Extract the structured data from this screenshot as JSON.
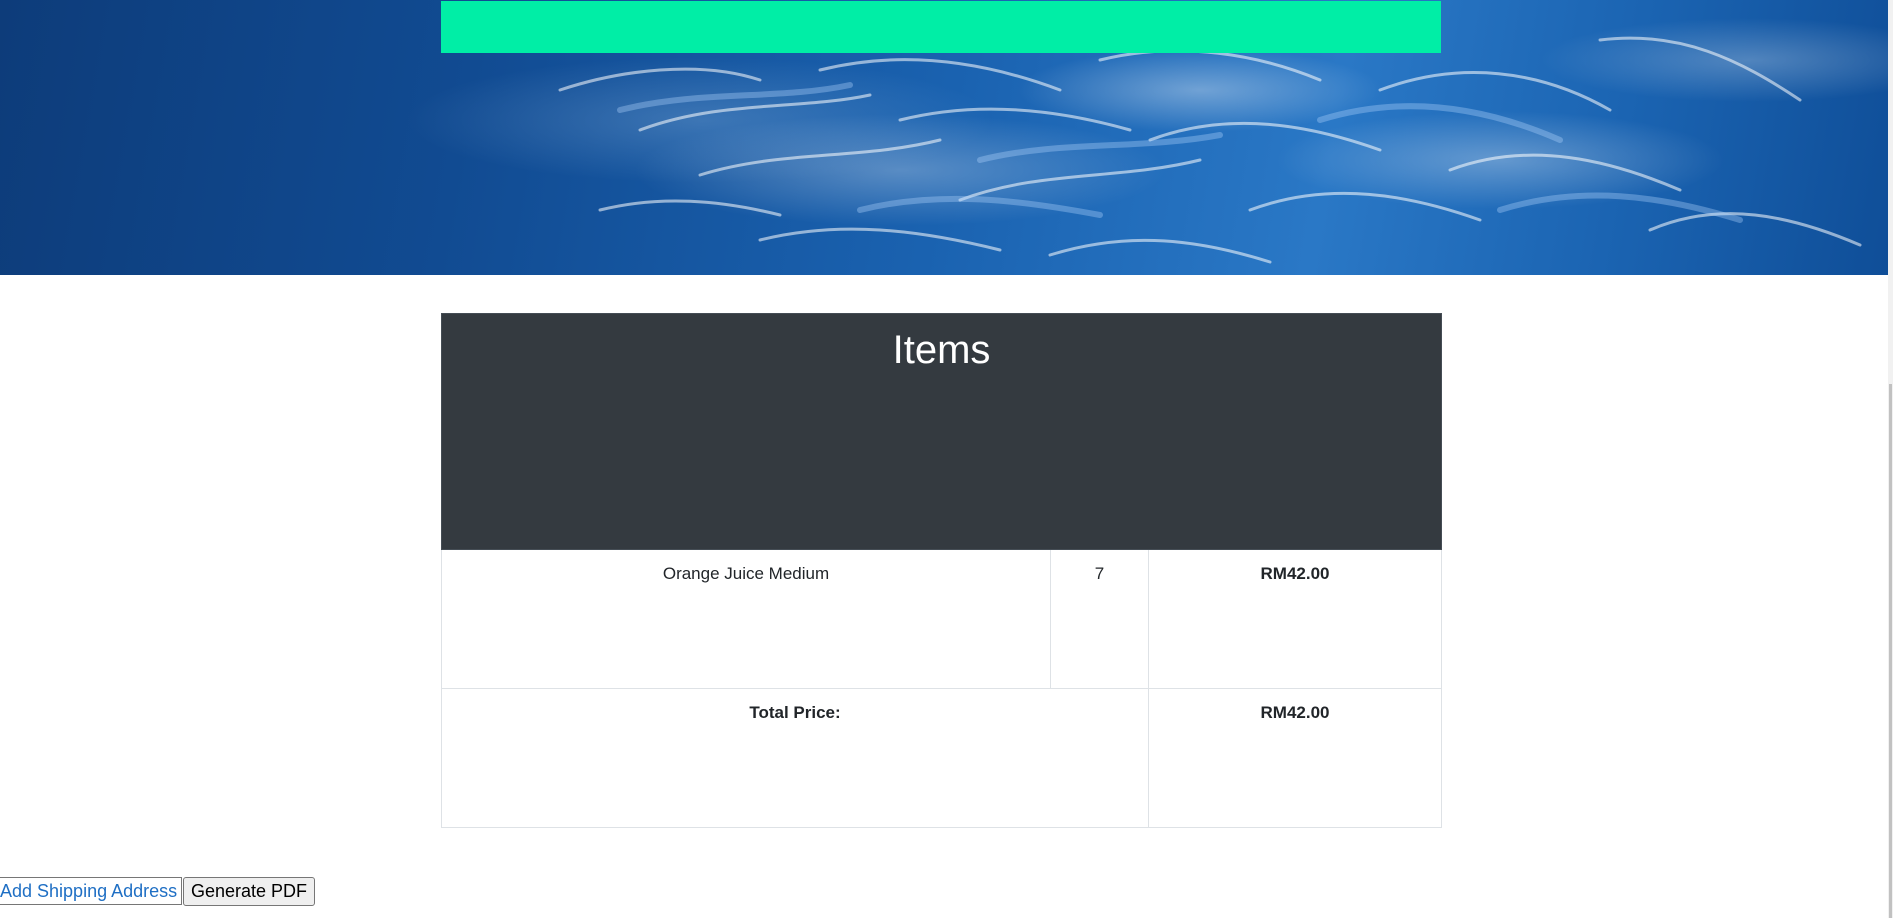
{
  "hero": {
    "strip_color": "#00eea6",
    "background_image": "water-texture"
  },
  "items_section": {
    "title": "Items"
  },
  "items": [
    {
      "name": "Orange Juice Medium",
      "quantity": "7",
      "price": "RM42.00"
    }
  ],
  "total": {
    "label": "Total Price:",
    "value": "RM42.00"
  },
  "actions": {
    "add_shipping_label": "Add Shipping Address",
    "generate_pdf_label": "Generate PDF"
  },
  "colors": {
    "header_bg": "#343a40",
    "link": "#1f6fc4",
    "accent_strip": "#00eea6"
  }
}
